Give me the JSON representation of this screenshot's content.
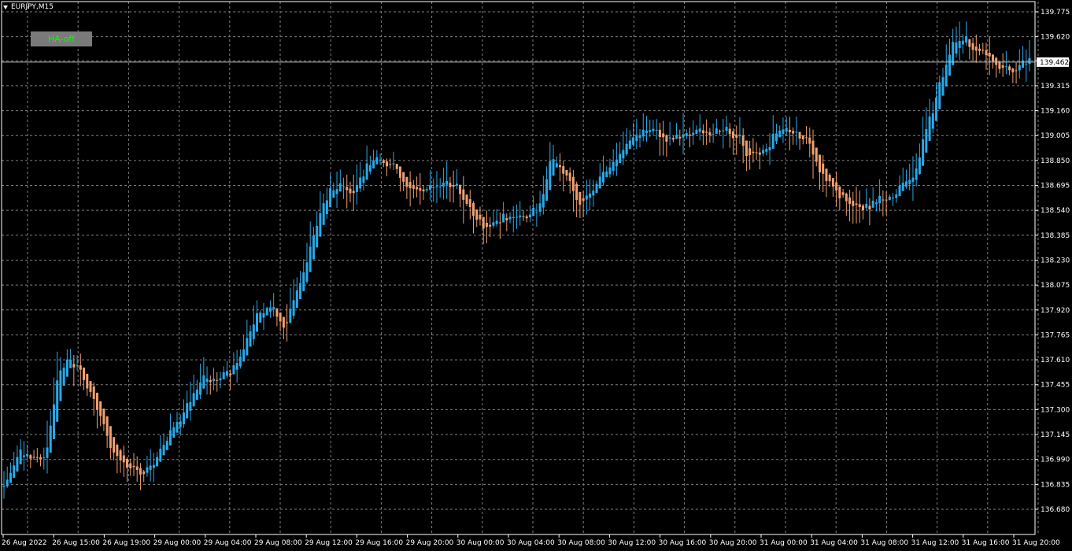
{
  "chart_data": {
    "type": "heikin-ashi",
    "symbol": "EURJPY,M15",
    "button_label": "HA-off",
    "current_price": 139.462,
    "ylim": [
      136.68,
      139.775
    ],
    "grid": true,
    "colors": {
      "bull": "#2aa9e8",
      "bear": "#f0a070",
      "grid": "#7f7f7f",
      "price_line": "#c0c0c0",
      "background": "#000000",
      "axis_text": "#ffffff"
    },
    "y_ticks": [
      139.775,
      139.62,
      139.47,
      139.315,
      139.16,
      139.005,
      138.85,
      138.695,
      138.54,
      138.385,
      138.23,
      138.075,
      137.92,
      137.765,
      137.61,
      137.455,
      137.3,
      137.145,
      136.99,
      136.835,
      136.68
    ],
    "y_tick_labels": [
      "139.775",
      "139.620",
      "139.470",
      "139.315",
      "139.160",
      "139.005",
      "138.850",
      "138.695",
      "138.540",
      "138.385",
      "138.230",
      "138.075",
      "137.920",
      "137.765",
      "137.610",
      "137.455",
      "137.300",
      "137.145",
      "136.990",
      "136.835",
      "136.680"
    ],
    "x_labels": [
      "26 Aug 2022",
      "26 Aug 15:00",
      "26 Aug 19:00",
      "29 Aug 00:00",
      "29 Aug 04:00",
      "29 Aug 08:00",
      "29 Aug 12:00",
      "29 Aug 16:00",
      "29 Aug 20:00",
      "30 Aug 00:00",
      "30 Aug 04:00",
      "30 Aug 08:00",
      "30 Aug 12:00",
      "30 Aug 16:00",
      "30 Aug 20:00",
      "31 Aug 00:00",
      "31 Aug 04:00",
      "31 Aug 08:00",
      "31 Aug 12:00",
      "31 Aug 16:00",
      "31 Aug 20:00"
    ],
    "price_path": [
      136.82,
      137.05,
      136.99,
      137.0,
      137.55,
      137.62,
      137.47,
      137.3,
      137.05,
      136.96,
      136.91,
      136.95,
      137.1,
      137.25,
      137.38,
      137.5,
      137.49,
      137.56,
      137.7,
      137.88,
      137.95,
      137.82,
      138.05,
      138.35,
      138.6,
      138.7,
      138.65,
      138.78,
      138.88,
      138.82,
      138.72,
      138.66,
      138.7,
      138.73,
      138.68,
      138.52,
      138.42,
      138.48,
      138.53,
      138.49,
      138.55,
      138.84,
      138.77,
      138.58,
      138.65,
      138.78,
      138.86,
      138.97,
      139.04,
      139.02,
      138.98,
      139.01,
      139.05,
      139.0,
      139.06,
      138.99,
      138.88,
      138.93,
      139.03,
      139.05,
      139.0,
      138.82,
      138.7,
      138.6,
      138.55,
      138.58,
      138.63,
      138.65,
      138.72,
      138.98,
      139.3,
      139.55,
      139.62,
      139.52,
      139.48,
      139.4,
      139.45,
      139.46
    ],
    "candles_per_segment": 4
  }
}
